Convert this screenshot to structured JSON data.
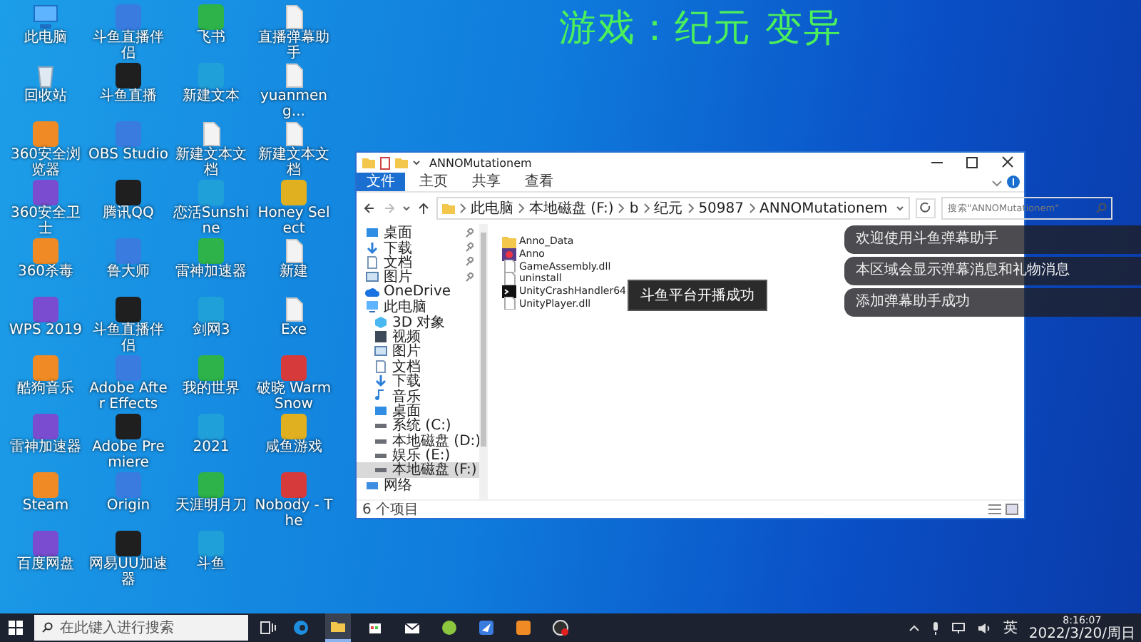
{
  "overlay_title": "游戏：纪元 变异",
  "desktop_icons": [
    {
      "label": "此电脑",
      "kind": "computer"
    },
    {
      "label": "斗鱼直播伴侣",
      "kind": "app"
    },
    {
      "label": "飞书",
      "kind": "app"
    },
    {
      "label": "直播弹幕助手",
      "kind": "document"
    },
    {
      "label": "回收站",
      "kind": "bin"
    },
    {
      "label": "斗鱼直播",
      "kind": "app"
    },
    {
      "label": "新建文本",
      "kind": "app"
    },
    {
      "label": "yuanmeng...",
      "kind": "document"
    },
    {
      "label": "360安全浏览器",
      "kind": "app"
    },
    {
      "label": "OBS Studio",
      "kind": "app"
    },
    {
      "label": "新建文本文档",
      "kind": "document"
    },
    {
      "label": "新建文本文档",
      "kind": "document"
    },
    {
      "label": "360安全卫士",
      "kind": "app"
    },
    {
      "label": "腾讯QQ",
      "kind": "app"
    },
    {
      "label": "恋活Sunshine",
      "kind": "app"
    },
    {
      "label": "Honey Select",
      "kind": "app"
    },
    {
      "label": "360杀毒",
      "kind": "app"
    },
    {
      "label": "鲁大师",
      "kind": "app"
    },
    {
      "label": "雷神加速器",
      "kind": "app"
    },
    {
      "label": "新建",
      "kind": "document"
    },
    {
      "label": "WPS 2019",
      "kind": "app"
    },
    {
      "label": "斗鱼直播伴侣",
      "kind": "app"
    },
    {
      "label": "剑网3",
      "kind": "app"
    },
    {
      "label": "Exe",
      "kind": "document"
    },
    {
      "label": "酷狗音乐",
      "kind": "app"
    },
    {
      "label": "Adobe After Effects",
      "kind": "app"
    },
    {
      "label": "我的世界",
      "kind": "app"
    },
    {
      "label": "破晓 Warm Snow",
      "kind": "app"
    },
    {
      "label": "雷神加速器",
      "kind": "app"
    },
    {
      "label": "Adobe Premiere",
      "kind": "app"
    },
    {
      "label": "2021",
      "kind": "app"
    },
    {
      "label": "咸鱼游戏",
      "kind": "app"
    },
    {
      "label": "Steam",
      "kind": "app"
    },
    {
      "label": "Origin",
      "kind": "app"
    },
    {
      "label": "天涯明月刀",
      "kind": "app"
    },
    {
      "label": "Nobody - The",
      "kind": "app"
    },
    {
      "label": "百度网盘",
      "kind": "app"
    },
    {
      "label": "网易UU加速器",
      "kind": "app"
    },
    {
      "label": "斗鱼",
      "kind": "app"
    }
  ],
  "explorer": {
    "title": "ANNOMutationem",
    "ribbon_tabs": [
      {
        "label": "文件",
        "selected": true
      },
      {
        "label": "主页",
        "selected": false
      },
      {
        "label": "共享",
        "selected": false
      },
      {
        "label": "查看",
        "selected": false
      }
    ],
    "path": [
      "此电脑",
      "本地磁盘 (F:)",
      "b",
      "纪元",
      "50987",
      "ANNOMutationem"
    ],
    "search": {
      "placeholder": "搜索\"ANNOMutationem\""
    },
    "nav_items": [
      {
        "label": "桌面",
        "kind": "desktop",
        "pinned": true,
        "selected": false
      },
      {
        "label": "下载",
        "kind": "download",
        "pinned": true,
        "selected": false
      },
      {
        "label": "文档",
        "kind": "doc",
        "pinned": true,
        "selected": false
      },
      {
        "label": "图片",
        "kind": "pictures",
        "pinned": true,
        "selected": false
      },
      {
        "label": "OneDrive",
        "kind": "cloud",
        "pinned": false,
        "selected": false
      },
      {
        "label": "此电脑",
        "kind": "pc",
        "pinned": false,
        "selected": false,
        "children": [
          {
            "label": "3D 对象",
            "kind": "cube",
            "pinned": false,
            "selected": false
          },
          {
            "label": "视频",
            "kind": "video",
            "pinned": false,
            "selected": false
          },
          {
            "label": "图片",
            "kind": "pictures",
            "pinned": false,
            "selected": false
          },
          {
            "label": "文档",
            "kind": "doc",
            "pinned": false,
            "selected": false
          },
          {
            "label": "下载",
            "kind": "download",
            "pinned": false,
            "selected": false
          },
          {
            "label": "音乐",
            "kind": "music",
            "pinned": false,
            "selected": false
          },
          {
            "label": "桌面",
            "kind": "desktop",
            "pinned": false,
            "selected": false
          },
          {
            "label": "系统 (C:)",
            "kind": "drive",
            "pinned": false,
            "selected": false
          },
          {
            "label": "本地磁盘 (D:)",
            "kind": "drive",
            "pinned": false,
            "selected": false
          },
          {
            "label": "娱乐 (E:)",
            "kind": "drive",
            "pinned": false,
            "selected": false
          },
          {
            "label": "本地磁盘 (F:)",
            "kind": "drive",
            "pinned": false,
            "selected": true
          }
        ]
      },
      {
        "label": "网络",
        "kind": "network",
        "pinned": false,
        "selected": false
      }
    ],
    "files": [
      {
        "name": "Anno_Data",
        "kind": "folder"
      },
      {
        "name": "Anno",
        "kind": "game"
      },
      {
        "name": "GameAssembly.dll",
        "kind": "file"
      },
      {
        "name": "uninstall",
        "kind": "file"
      },
      {
        "name": "UnityCrashHandler64",
        "kind": "console"
      },
      {
        "name": "UnityPlayer.dll",
        "kind": "file"
      }
    ],
    "tooltip": "斗鱼平台开播成功",
    "status": "6 个项目"
  },
  "notifications": [
    "欢迎使用斗鱼弹幕助手",
    "本区域会显示弹幕消息和礼物消息",
    "添加弹幕助手成功"
  ],
  "taskbar": {
    "search": {
      "placeholder": "在此键入进行搜索"
    },
    "apps": [
      {
        "kind": "edge",
        "active": false
      },
      {
        "kind": "explorer",
        "active": true
      },
      {
        "kind": "store",
        "active": false
      },
      {
        "kind": "mail",
        "active": false
      },
      {
        "kind": "green",
        "active": false
      },
      {
        "kind": "bird",
        "active": false
      },
      {
        "kind": "douyu",
        "active": false
      },
      {
        "kind": "obs",
        "active": false
      }
    ],
    "ime": "英",
    "time": "8:16:07",
    "date": "2022/3/20/周日"
  }
}
